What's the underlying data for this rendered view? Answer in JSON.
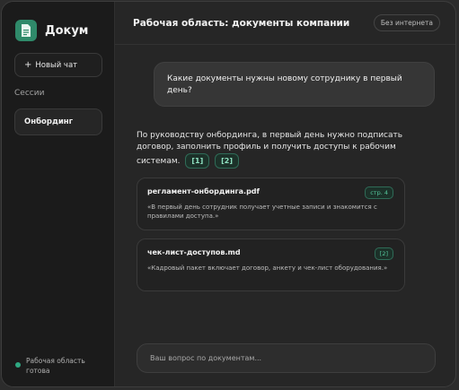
{
  "sidebar": {
    "brand": "Докум",
    "new_chat": "Новый чат",
    "sessions_label": "Сессии",
    "sessions": [
      {
        "label": "Онбординг"
      }
    ],
    "status": "Рабочая область готова"
  },
  "header": {
    "title": "Рабочая область: документы компании",
    "badge": "Без интернета"
  },
  "chat": {
    "user_message": "Какие документы нужны новому сотруднику в первый день?",
    "answer": "По руководству онбординга, в первый день нужно подписать договор, заполнить профиль и получить доступы к рабочим системам.",
    "citations": [
      "[1]",
      "[2]"
    ],
    "sources": [
      {
        "file": "регламент-онбординга.pdf",
        "tag": "стр. 4",
        "quote": "«В первый день сотрудник получает учетные записи и знакомится с правилами доступа.»"
      },
      {
        "file": "чек-лист-доступов.md",
        "tag": "[2]",
        "quote": "«Кадровый пакет включает договор, анкету и чек-лист оборудования.»"
      }
    ]
  },
  "input": {
    "placeholder": "Ваш вопрос по документам..."
  },
  "colors": {
    "accent": "#2f8a6a",
    "sidebar_bg": "#1b1b1b",
    "main_bg": "#262626"
  }
}
